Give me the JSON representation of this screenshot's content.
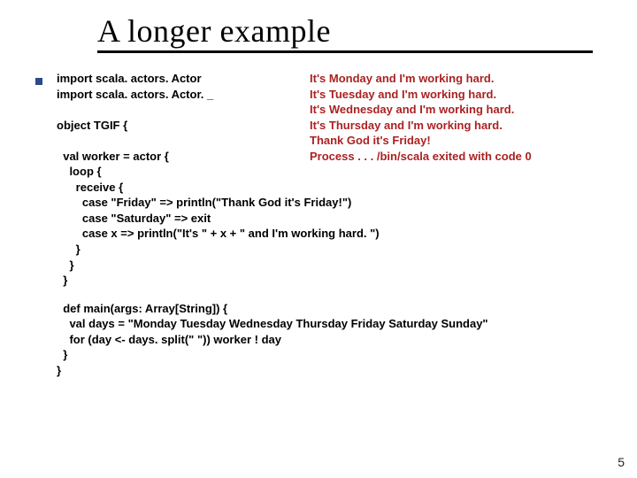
{
  "title": "A longer example",
  "code": "import scala. actors. Actor\nimport scala. actors. Actor. _\n\nobject TGIF {\n\n  val worker = actor {\n    loop {\n      receive {\n        case \"Friday\" => println(\"Thank God it's Friday!\")\n        case \"Saturday\" => exit\n        case x => println(\"It's \" + x + \" and I'm working hard. \")\n      }\n    }\n  }",
  "code2": "  def main(args: Array[String]) {\n    val days = \"Monday Tuesday Wednesday Thursday Friday Saturday Sunday\"\n    for (day <- days. split(\" \")) worker ! day\n  }\n}",
  "output": "It's Monday and I'm working hard.\nIt's Tuesday and I'm working hard.\nIt's Wednesday and I'm working hard.\nIt's Thursday and I'm working hard.\nThank God it's Friday!\nProcess . . . /bin/scala exited with code 0",
  "pagenum": "5"
}
